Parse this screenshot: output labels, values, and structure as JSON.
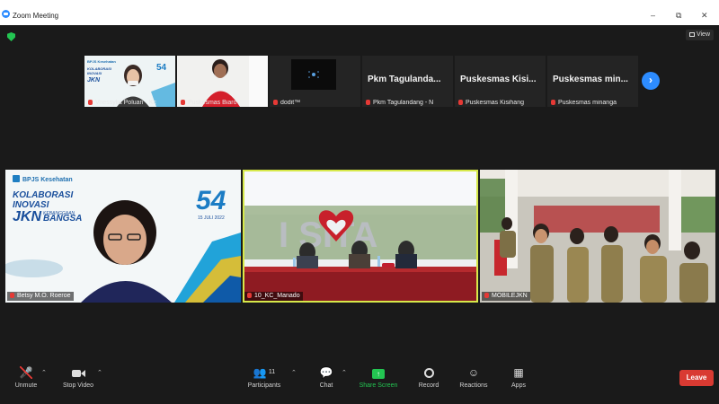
{
  "window": {
    "title": "Zoom Meeting",
    "controls": [
      "minimize",
      "restore",
      "close"
    ]
  },
  "topbar": {
    "view_label": "View"
  },
  "thumbnails": [
    {
      "name": "Vriessylia Poluan - Kc",
      "muted": true,
      "type": "video"
    },
    {
      "name": "Puskesmas Biaro",
      "muted": true,
      "type": "video"
    },
    {
      "name": "dodit™",
      "muted": true,
      "type": "video"
    },
    {
      "display_name": "Pkm Tagulanda...",
      "name": "Pkm Tagulandang - N",
      "muted": true,
      "type": "name"
    },
    {
      "display_name": "Puskesmas Kisi...",
      "name": "Puskesmas Kisihang",
      "muted": true,
      "type": "name"
    },
    {
      "display_name": "Puskesmas min...",
      "name": "Puskesmas minanga",
      "muted": true,
      "type": "name"
    }
  ],
  "tiles": [
    {
      "name": "Betsy M.O. Roeroe",
      "slide": {
        "org": "BPJS Kesehatan",
        "line1": "KOLABORASI",
        "line2": "INOVASI",
        "line3": "JKN",
        "line4": "KEBANGGAAN",
        "line5": "BANGSA",
        "anniv": "54",
        "date": "15 JULI 2022"
      }
    },
    {
      "name": "10_KC_Manado",
      "active": true,
      "sign": "I SITA"
    },
    {
      "name": "MOBILEJKN"
    }
  ],
  "toolbar": {
    "unmute": "Unmute",
    "stop_video": "Stop Video",
    "participants": "Participants",
    "participants_count": "11",
    "chat": "Chat",
    "share_screen": "Share Screen",
    "record": "Record",
    "reactions": "Reactions",
    "apps": "Apps",
    "leave": "Leave"
  },
  "colors": {
    "accent": "#2d8cff",
    "share": "#23c552",
    "leave": "#d93a32",
    "active_border": "#d7e94a"
  }
}
